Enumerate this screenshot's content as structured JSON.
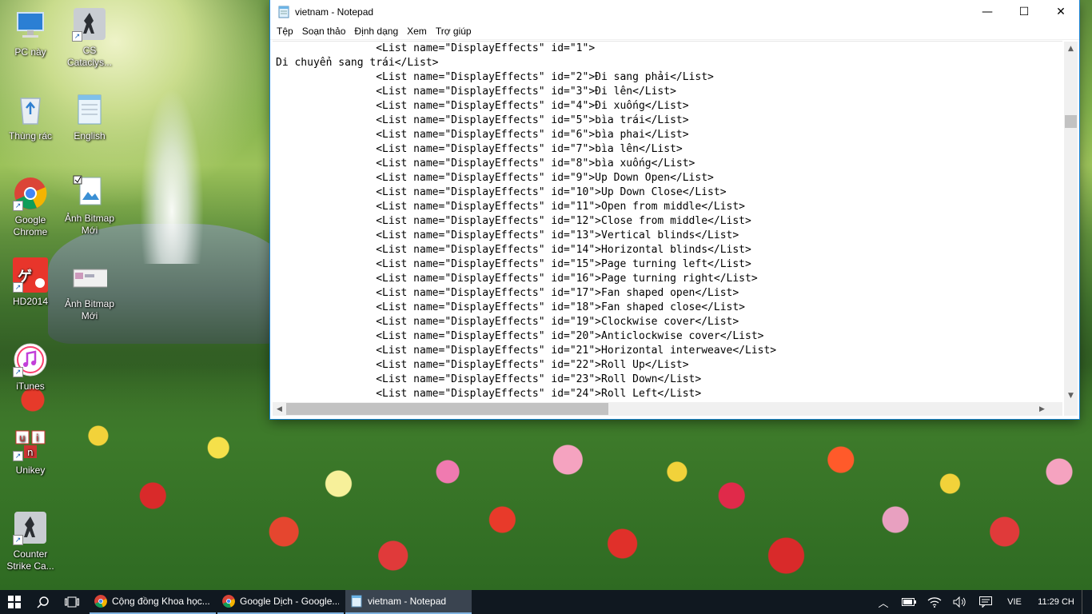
{
  "desktop": {
    "icons": [
      {
        "label": "PC này",
        "icon": "computer-icon"
      },
      {
        "label": "CS Cataclys...",
        "icon": "counter-strike-icon"
      },
      {
        "label": "Thùng rác",
        "icon": "recycle-bin-icon"
      },
      {
        "label": "English",
        "icon": "notepad-file-icon"
      },
      {
        "label": "Google Chrome",
        "icon": "chrome-icon"
      },
      {
        "label": "Ảnh Bitmap Mới",
        "icon": "bitmap-file-icon"
      },
      {
        "label": "HD2014",
        "icon": "hd2014-icon"
      },
      {
        "label": "Ảnh Bitmap Mới",
        "icon": "bitmap-file-icon"
      },
      {
        "label": "iTunes",
        "icon": "itunes-icon"
      },
      {
        "label": "Unikey",
        "icon": "unikey-icon"
      },
      {
        "label": "Counter Strike Ca...",
        "icon": "counter-strike-icon"
      }
    ]
  },
  "notepad": {
    "title": "vietnam - Notepad",
    "controls": {
      "minimize": "—",
      "maximize": "☐",
      "close": "✕"
    },
    "menu": [
      "Tệp",
      "Soạn thảo",
      "Định dạng",
      "Xem",
      "Trợ giúp"
    ],
    "lines": [
      "                <List name=\"DisplayEffects\" id=\"1\">",
      "Di chuyển sang trái</List>",
      "                <List name=\"DisplayEffects\" id=\"2\">Đi sang phải</List>",
      "                <List name=\"DisplayEffects\" id=\"3\">Đi lên</List>",
      "                <List name=\"DisplayEffects\" id=\"4\">Đi xuống</List>",
      "                <List name=\"DisplayEffects\" id=\"5\">bìa trái</List>",
      "                <List name=\"DisplayEffects\" id=\"6\">bìa phai</List>",
      "                <List name=\"DisplayEffects\" id=\"7\">bìa lên</List>",
      "                <List name=\"DisplayEffects\" id=\"8\">bìa xuống</List>",
      "                <List name=\"DisplayEffects\" id=\"9\">Up Down Open</List>",
      "                <List name=\"DisplayEffects\" id=\"10\">Up Down Close</List>",
      "                <List name=\"DisplayEffects\" id=\"11\">Open from middle</List>",
      "                <List name=\"DisplayEffects\" id=\"12\">Close from middle</List>",
      "                <List name=\"DisplayEffects\" id=\"13\">Vertical blinds</List>",
      "                <List name=\"DisplayEffects\" id=\"14\">Horizontal blinds</List>",
      "                <List name=\"DisplayEffects\" id=\"15\">Page turning left</List>",
      "                <List name=\"DisplayEffects\" id=\"16\">Page turning right</List>",
      "                <List name=\"DisplayEffects\" id=\"17\">Fan shaped open</List>",
      "                <List name=\"DisplayEffects\" id=\"18\">Fan shaped close</List>",
      "                <List name=\"DisplayEffects\" id=\"19\">Clockwise cover</List>",
      "                <List name=\"DisplayEffects\" id=\"20\">Anticlockwise cover</List>",
      "                <List name=\"DisplayEffects\" id=\"21\">Horizontal interweave</List>",
      "                <List name=\"DisplayEffects\" id=\"22\">Roll Up</List>",
      "                <List name=\"DisplayEffects\" id=\"23\">Roll Down</List>",
      "                <List name=\"DisplayEffects\" id=\"24\">Roll Left</List>"
    ]
  },
  "taskbar": {
    "apps": [
      {
        "label": "Cộng đồng Khoa học...",
        "icon": "chrome-icon",
        "active": false
      },
      {
        "label": "Google Dịch - Google...",
        "icon": "chrome-icon",
        "active": false
      },
      {
        "label": "vietnam - Notepad",
        "icon": "notepad-icon",
        "active": true
      }
    ],
    "language": "VIE",
    "clock": "11:29 CH"
  },
  "colors": {
    "window_border": "#1883d7",
    "taskbar_bg": "#101820",
    "active_task": "#3a4450"
  }
}
